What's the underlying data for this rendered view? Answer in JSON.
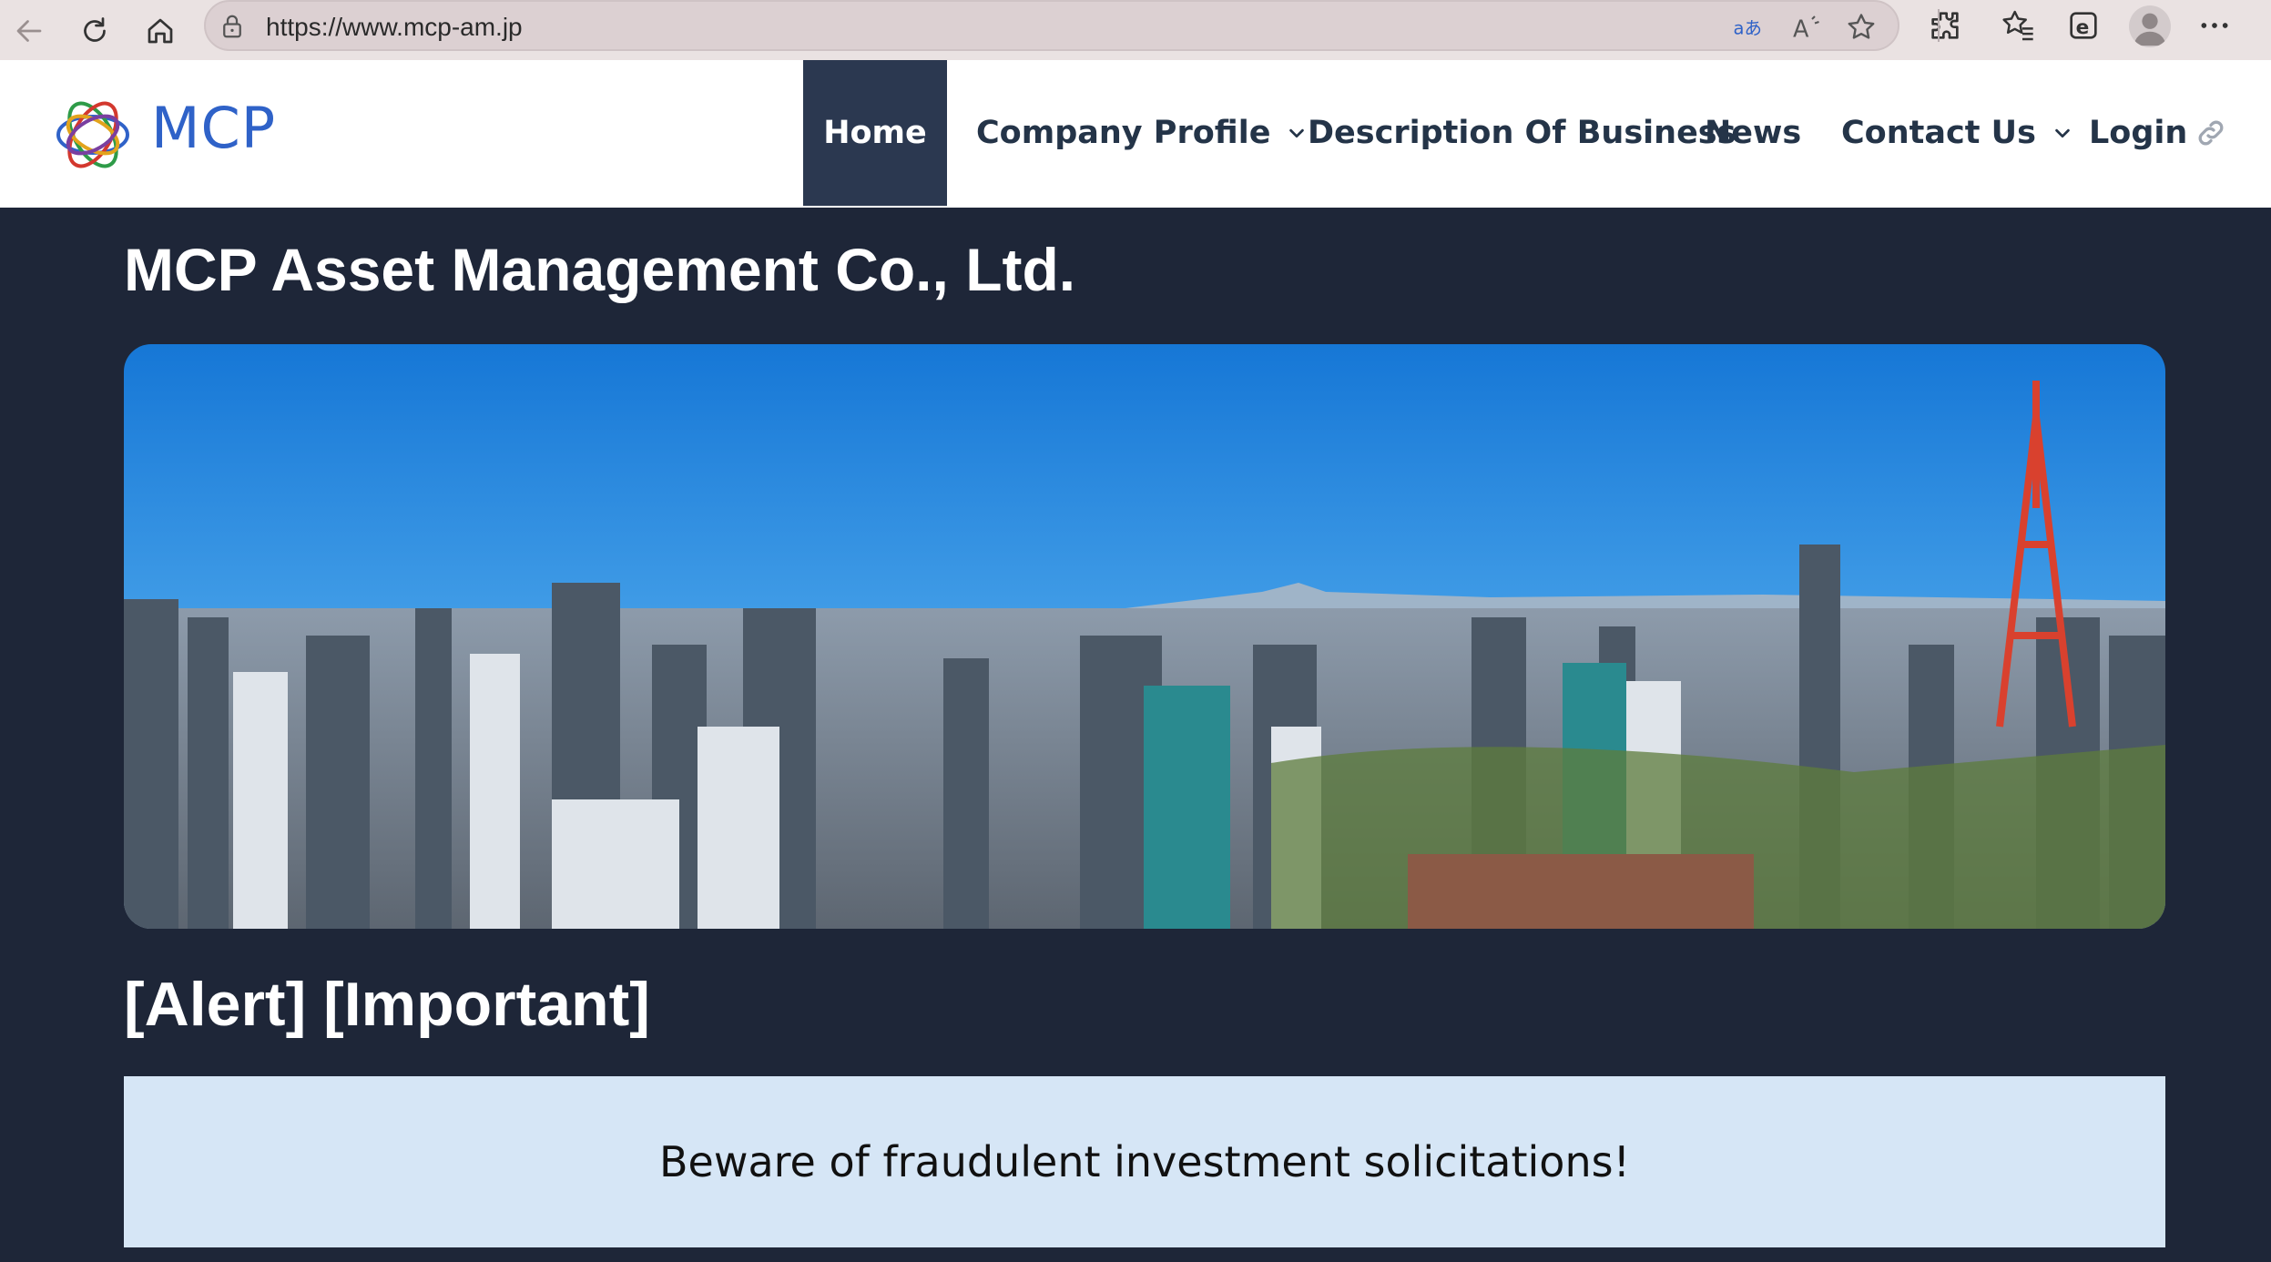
{
  "browser": {
    "url": "https://www.mcp-am.jp",
    "icons": [
      "back-icon",
      "refresh-icon",
      "home-icon",
      "lock-icon",
      "translate-icon",
      "read-aloud-icon",
      "favorite-star-icon",
      "extensions-icon",
      "favorites-icon",
      "collections-icon",
      "profile-icon",
      "more-icon"
    ]
  },
  "site": {
    "logo_text": "MCP",
    "brand_color": "#2f62c8",
    "nav": {
      "home": "Home",
      "company_profile": "Company Profile",
      "description": "Description Of Business",
      "news": "News",
      "contact": "Contact Us",
      "login": "Login"
    }
  },
  "main": {
    "title": "MCP Asset Management Co., Ltd.",
    "alert_heading": "[Alert] [Important]",
    "alert_text": "Beware of fraudulent investment solicitations!"
  },
  "colors": {
    "page_bg": "#1e2638",
    "nav_active_bg": "#2b3850",
    "alert_bg": "#d6e6f6"
  }
}
